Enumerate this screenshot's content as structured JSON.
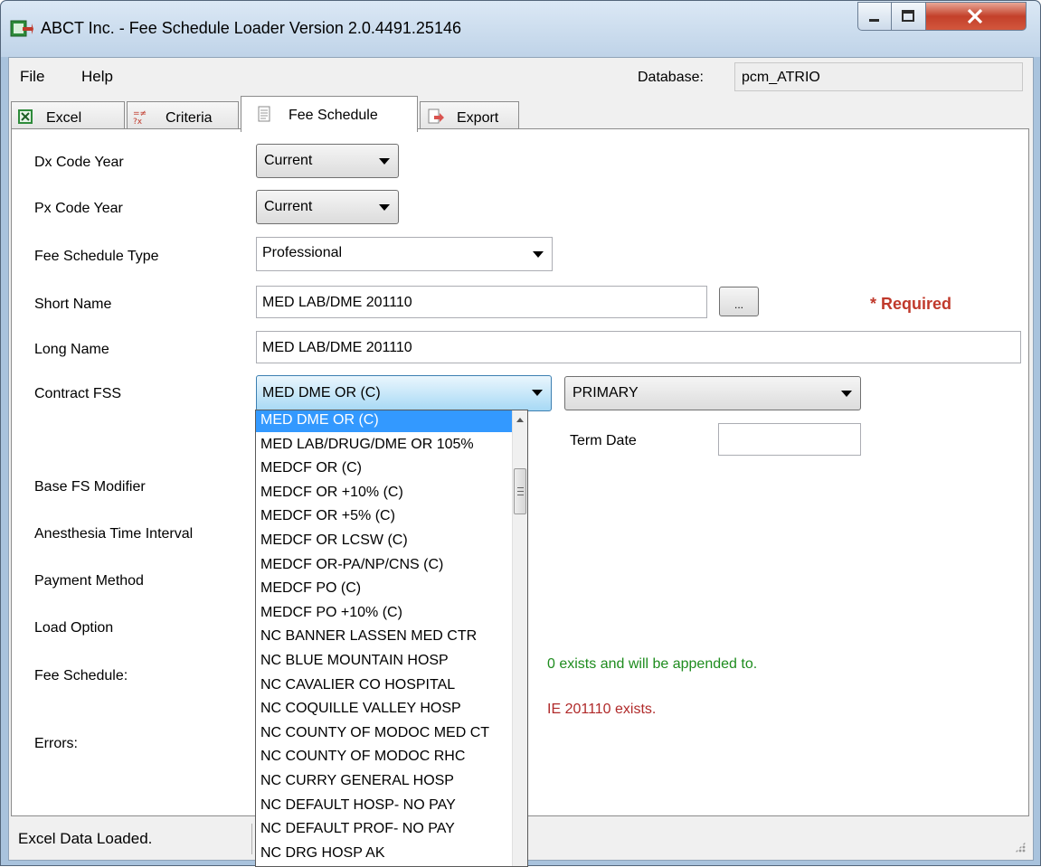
{
  "window": {
    "title": "ABCT Inc. - Fee Schedule Loader Version 2.0.4491.25146",
    "minimize": "minimize",
    "maximize": "maximize",
    "close": "close"
  },
  "menu": {
    "file": "File",
    "help": "Help"
  },
  "database": {
    "label": "Database:",
    "value": "pcm_ATRIO"
  },
  "tabs": [
    {
      "label": "Excel",
      "icon": "excel-icon"
    },
    {
      "label": "Criteria",
      "icon": "criteria-icon"
    },
    {
      "label": "Fee Schedule",
      "icon": "document-icon"
    },
    {
      "label": "Export",
      "icon": "export-icon"
    }
  ],
  "form": {
    "dx_code_year": {
      "label": "Dx Code Year",
      "value": "Current"
    },
    "px_code_year": {
      "label": "Px Code Year",
      "value": "Current"
    },
    "fee_schedule_type": {
      "label": "Fee Schedule Type",
      "value": "Professional"
    },
    "short_name": {
      "label": "Short Name",
      "value": "MED LAB/DME 201110",
      "button": "...",
      "required": "* Required"
    },
    "long_name": {
      "label": "Long Name",
      "value": "MED LAB/DME 201110"
    },
    "contract_fss": {
      "label": "Contract FSS",
      "value": "MED DME OR (C)",
      "secondary": "PRIMARY"
    },
    "term_date": {
      "label": "Term Date",
      "value": ""
    },
    "base_fs_modifier": {
      "label": "Base FS Modifier"
    },
    "anesthesia_time_interval": {
      "label": "Anesthesia Time Interval"
    },
    "payment_method": {
      "label": "Payment Method"
    },
    "load_option": {
      "label": "Load Option"
    },
    "fee_schedule_status": {
      "label": "Fee Schedule:",
      "message": "0 exists and will be appended to."
    },
    "errors": {
      "label": "Errors:",
      "message": "IE 201110 exists."
    }
  },
  "dropdown": {
    "items": [
      "MED DME OR (C)",
      "MED LAB/DRUG/DME OR 105%",
      "MEDCF OR (C)",
      "MEDCF OR +10% (C)",
      "MEDCF OR +5% (C)",
      "MEDCF OR LCSW (C)",
      "MEDCF OR-PA/NP/CNS (C)",
      "MEDCF PO (C)",
      "MEDCF PO +10% (C)",
      "NC BANNER LASSEN MED CTR",
      "NC BLUE MOUNTAIN HOSP",
      "NC CAVALIER CO HOSPITAL",
      "NC COQUILLE VALLEY HOSP",
      "NC COUNTY OF MODOC MED CT",
      "NC COUNTY OF MODOC RHC",
      "NC CURRY GENERAL HOSP",
      "NC DEFAULT HOSP- NO PAY",
      "NC DEFAULT PROF- NO PAY",
      "NC DRG HOSP AK"
    ],
    "selected_index": 0
  },
  "statusbar": {
    "text": "Excel Data Loaded."
  },
  "colors": {
    "required": "#c0392b",
    "success": "#1e8c1e",
    "error": "#b02a2a",
    "selection": "#3399ff"
  }
}
